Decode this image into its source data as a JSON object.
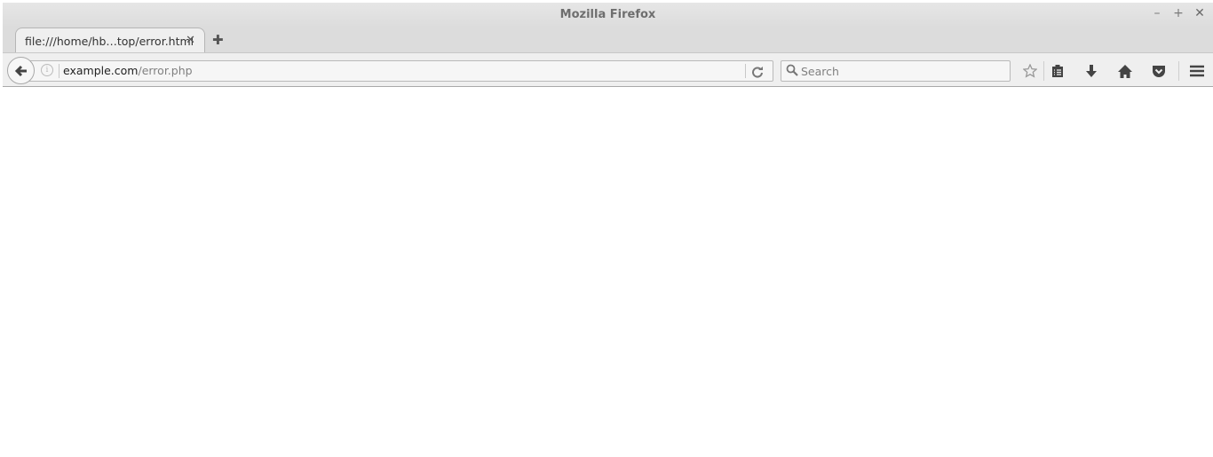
{
  "window": {
    "title": "Mozilla Firefox",
    "controls": {
      "minimize": "–",
      "maximize": "+",
      "close": "✕"
    }
  },
  "tabs": [
    {
      "label": "file:///home/hb…top/error.html",
      "close": "✕",
      "active": true
    }
  ],
  "new_tab_label": "✚",
  "navbar": {
    "url_host": "example.com",
    "url_path": "/error.php",
    "info_glyph": "i",
    "search_placeholder": "Search"
  },
  "toolbar_icons": [
    "bookmark-star-icon",
    "reading-list-icon",
    "downloads-icon",
    "home-icon",
    "pocket-icon",
    "hamburger-menu-icon"
  ]
}
